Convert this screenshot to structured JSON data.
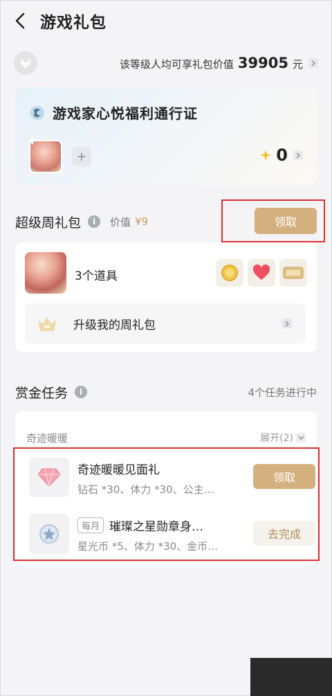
{
  "header": {
    "title": "游戏礼包"
  },
  "level": {
    "text_prefix": "该等级人均可享礼包价值",
    "value": "39905",
    "unit": "元"
  },
  "pass": {
    "title": "游戏家心悦福利通行证",
    "plus": "+",
    "points": "0"
  },
  "weekly": {
    "title": "超级周礼包",
    "value_label": "价值",
    "value_price": "¥9",
    "claim_label": "领取",
    "items_count": "3个道具",
    "upgrade_label": "升级我的周礼包"
  },
  "bounty": {
    "title": "赏金任务",
    "status": "4个任务进行中",
    "group_name": "奇迹暖暖",
    "expand_label": "展开(2)",
    "tasks": [
      {
        "name": "奇迹暖暖见面礼",
        "desc": "钻石 *30、体力 *30、公主…",
        "action": "领取"
      },
      {
        "tag": "每月",
        "name": "璀璨之星勋章身…",
        "desc": "星光币 *5、体力 *30、金币…",
        "action": "去完成"
      }
    ]
  },
  "colors": {
    "gold": "#d4b07f",
    "highlight": "#d9302f"
  }
}
